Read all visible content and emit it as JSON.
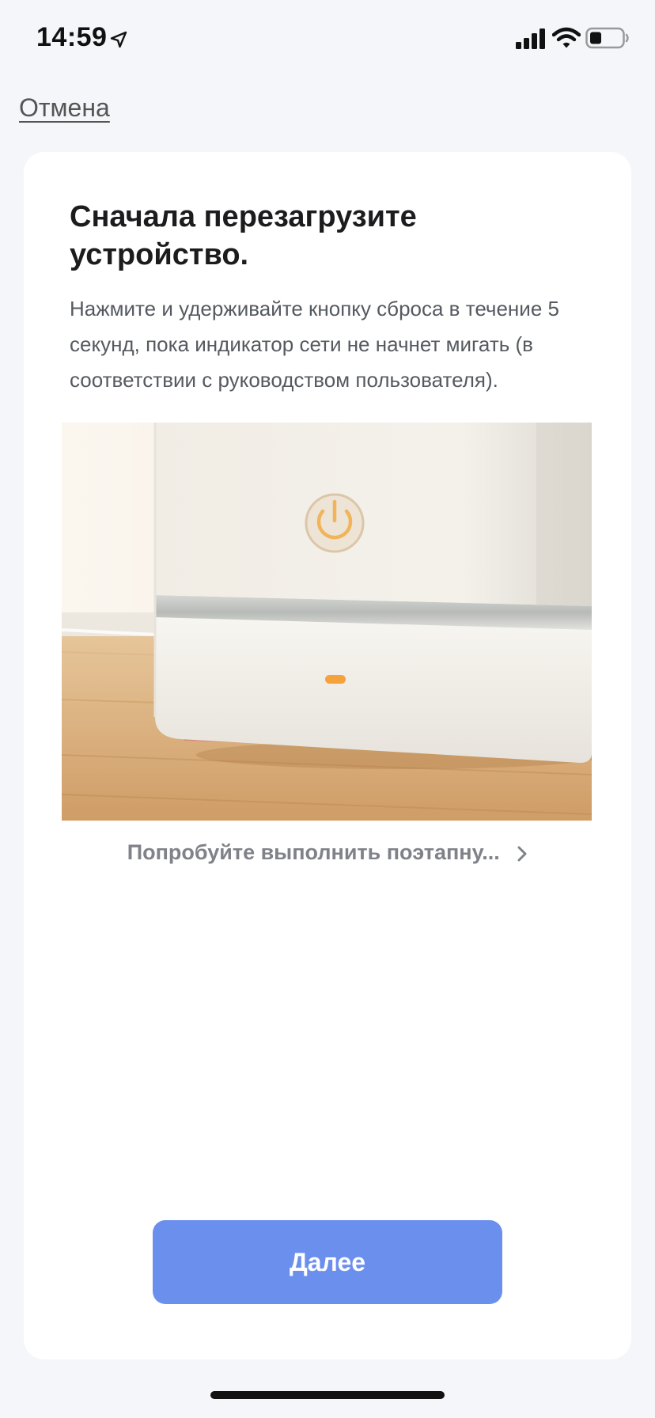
{
  "status_bar": {
    "time": "14:59"
  },
  "header": {
    "cancel_label": "Отмена"
  },
  "card": {
    "title": "Сначала перезагрузите устройство.",
    "description": "Нажмите и удерживайте кнопку сброса в течение 5 секунд, пока индикатор сети не начнет мигать  (в соответствии с руководством пользователя).",
    "guide_link_label": "Попробуйте выполнить поэтапну...",
    "next_button_label": "Далее"
  },
  "icons": {
    "location": "location-arrow-icon",
    "signal": "cellular-signal-icon",
    "wifi": "wifi-icon",
    "battery": "battery-icon",
    "guide_chevron": "chevron-right-icon",
    "device_power": "power-icon"
  },
  "colors": {
    "accent_button": "#6b8fec",
    "background": "#f5f6fa",
    "card": "#ffffff",
    "indicator_led": "#f5a23a"
  }
}
